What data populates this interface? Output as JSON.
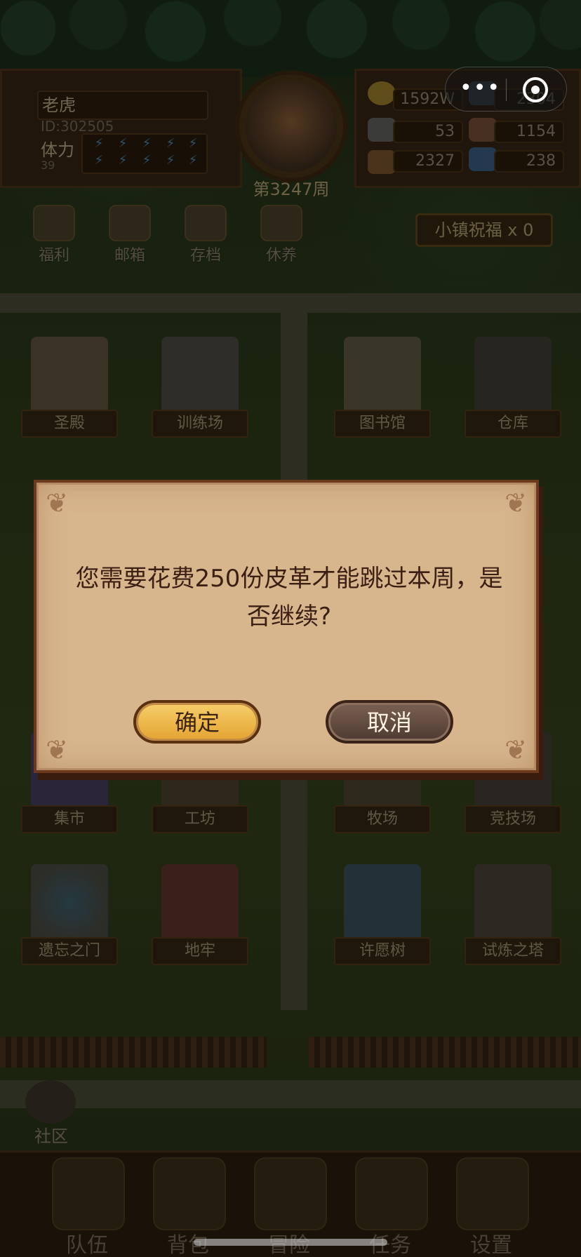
{
  "player": {
    "name": "老虎",
    "id_text": "ID:302505",
    "stamina_label": "体力",
    "stamina_value": "39"
  },
  "week_label": "第3247周",
  "resources": [
    {
      "icon": "gold-coin-icon",
      "value": "1592W"
    },
    {
      "icon": "crystal-icon",
      "value": "2304"
    },
    {
      "icon": "ore-icon",
      "value": "53"
    },
    {
      "icon": "leather-icon",
      "value": "1154"
    },
    {
      "icon": "wood-icon",
      "value": "2327"
    },
    {
      "icon": "gem-icon",
      "value": "238"
    }
  ],
  "quick_actions": [
    {
      "label": "福利",
      "icon": "wheel-icon"
    },
    {
      "label": "邮箱",
      "icon": "mail-icon"
    },
    {
      "label": "存档",
      "icon": "scroll-icon"
    },
    {
      "label": "休养",
      "icon": "bed-icon"
    }
  ],
  "town_blessing": "小镇祝福 x 0",
  "buildings_row1": [
    "圣殿",
    "训练场",
    "图书馆",
    "仓库"
  ],
  "buildings_row3": [
    "集市",
    "工坊",
    "牧场",
    "竞技场"
  ],
  "buildings_row4": [
    "遗忘之门",
    "地牢",
    "许愿树",
    "试炼之塔"
  ],
  "social_label": "社区",
  "nav": [
    "队伍",
    "背包",
    "冒险",
    "任务",
    "设置"
  ],
  "dialog": {
    "message": "您需要花费250份皮革才能跳过本周，是否继续?",
    "confirm": "确定",
    "cancel": "取消"
  },
  "colors": {
    "dialog_bg": "#d7b58d",
    "confirm_btn": "#f0bb4a",
    "cancel_btn": "#5f483c"
  }
}
